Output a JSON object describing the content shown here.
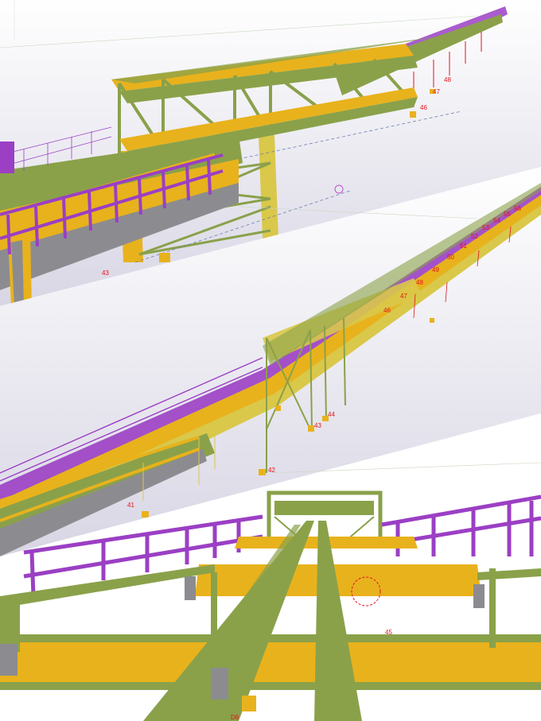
{
  "colors": {
    "primary_beam": "#e8b21c",
    "secondary_beam": "#8aa14a",
    "railing": "#9b3fc4",
    "column": "#d9c84a",
    "grey_steel": "#8c8c90",
    "label_red": "#e0141c",
    "background": "#ffffff"
  },
  "panel_top": {
    "labels": [
      "43",
      "46",
      "47",
      "48"
    ]
  },
  "panel_middle": {
    "labels": [
      "41",
      "42",
      "43",
      "44",
      "46",
      "47",
      "48",
      "49",
      "50",
      "51",
      "52",
      "53",
      "54",
      "55",
      "56"
    ]
  },
  "panel_bottom": {
    "labels": [
      "45",
      "D6"
    ]
  }
}
